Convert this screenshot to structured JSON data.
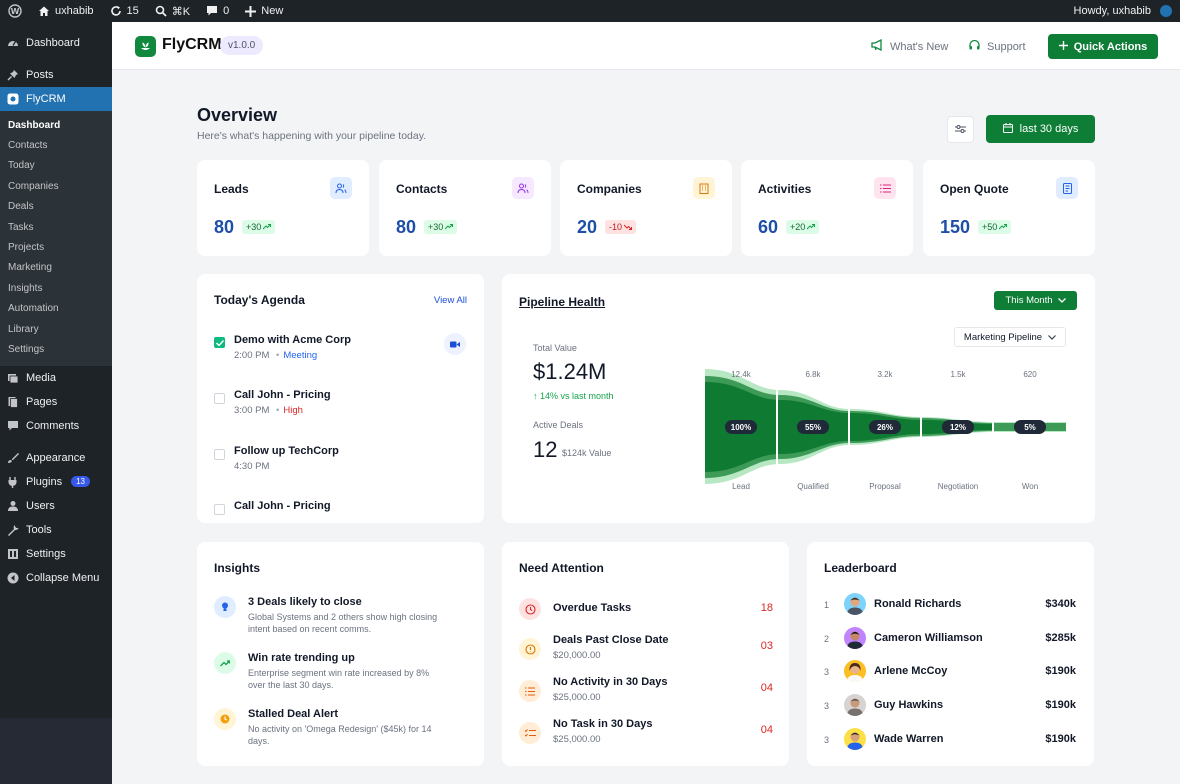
{
  "adminbar": {
    "site": "uxhabib",
    "updates": "15",
    "shortcut": "⌘K",
    "comments": "0",
    "new": "New",
    "howdy": "Howdy, uxhabib"
  },
  "wp_menu": {
    "dashboard": "Dashboard",
    "posts": "Posts",
    "flycrm": "FlyCRM",
    "sub": [
      "Dashboard",
      "Contacts",
      "Today",
      "Companies",
      "Deals",
      "Tasks",
      "Projects",
      "Marketing",
      "Insights",
      "Automation",
      "Library",
      "Settings"
    ],
    "media": "Media",
    "pages": "Pages",
    "comments": "Comments",
    "appearance": "Appearance",
    "plugins": "Plugins",
    "plugins_badge": "13",
    "users": "Users",
    "tools": "Tools",
    "settings": "Settings",
    "collapse": "Collapse Menu"
  },
  "header": {
    "brand": "FlyCRM",
    "version": "v1.0.0",
    "whats_new": "What's New",
    "support": "Support",
    "quick_actions": "Quick Actions",
    "accent": "#0e7d35"
  },
  "overview": {
    "title": "Overview",
    "subtitle": "Here's what's happening with your pipeline today.",
    "date_range": "last 30 days"
  },
  "stats": [
    {
      "label": "Leads",
      "value": "80",
      "delta": "+30",
      "trend": "up"
    },
    {
      "label": "Contacts",
      "value": "80",
      "delta": "+30",
      "trend": "up"
    },
    {
      "label": "Companies",
      "value": "20",
      "delta": "-10",
      "trend": "down"
    },
    {
      "label": "Activities",
      "value": "60",
      "delta": "+20",
      "trend": "up"
    },
    {
      "label": "Open Quote",
      "value": "150",
      "delta": "+50",
      "trend": "up"
    }
  ],
  "agenda": {
    "title": "Today's Agenda",
    "view_all": "View All",
    "items": [
      {
        "title": "Demo with Acme Corp",
        "time": "2:00 PM",
        "sep": "•",
        "tag": "Meeting",
        "done": true
      },
      {
        "title": "Call John - Pricing",
        "time": "3:00 PM",
        "sep": "•",
        "tag": "High",
        "done": false
      },
      {
        "title": "Follow up TechCorp",
        "time": "4:30 PM",
        "sep": "",
        "tag": "",
        "done": false
      },
      {
        "title": "Call John - Pricing",
        "time": "",
        "sep": "",
        "tag": "",
        "done": false
      }
    ]
  },
  "pipeline": {
    "title": "Pipeline Health",
    "period": "This Month",
    "selector": "Marketing Pipeline",
    "total_label": "Total Value",
    "total_value": "$1.24M",
    "change": "↑ 14% vs last month",
    "deals_label": "Active Deals",
    "deals_count": "12",
    "deals_value": "$124k Value",
    "stages": [
      {
        "name": "Lead",
        "count": "12.4k",
        "pct": "100%"
      },
      {
        "name": "Qualified",
        "count": "6.8k",
        "pct": "55%"
      },
      {
        "name": "Proposal",
        "count": "3.2k",
        "pct": "26%"
      },
      {
        "name": "Negotiation",
        "count": "1.5k",
        "pct": "12%"
      },
      {
        "name": "Won",
        "count": "620",
        "pct": "5%"
      }
    ]
  },
  "insights": {
    "title": "Insights",
    "items": [
      {
        "title": "3 Deals likely to close",
        "desc": "Global Systems and 2 others show high closing intent based on recent comms."
      },
      {
        "title": "Win rate trending up",
        "desc": "Enterprise segment win rate increased by 8% over the last 30 days."
      },
      {
        "title": "Stalled Deal Alert",
        "desc": "No activity on 'Omega Redesign' ($45k) for 14 days."
      }
    ]
  },
  "attention": {
    "title": "Need Attention",
    "items": [
      {
        "title": "Overdue Tasks",
        "sub": "",
        "count": "18"
      },
      {
        "title": "Deals Past Close Date",
        "sub": "$20,000.00",
        "count": "03"
      },
      {
        "title": "No Activity in 30 Days",
        "sub": "$25,000.00",
        "count": "04"
      },
      {
        "title": "No Task in 30 Days",
        "sub": "$25,000.00",
        "count": "04"
      }
    ]
  },
  "leaderboard": {
    "title": "Leaderboard",
    "rows": [
      {
        "rank": "1",
        "name": "Ronald Richards",
        "amount": "$340k"
      },
      {
        "rank": "2",
        "name": "Cameron Williamson",
        "amount": "$285k"
      },
      {
        "rank": "3",
        "name": "Arlene McCoy",
        "amount": "$190k"
      },
      {
        "rank": "3",
        "name": "Guy Hawkins",
        "amount": "$190k"
      },
      {
        "rank": "3",
        "name": "Wade Warren",
        "amount": "$190k"
      }
    ]
  }
}
